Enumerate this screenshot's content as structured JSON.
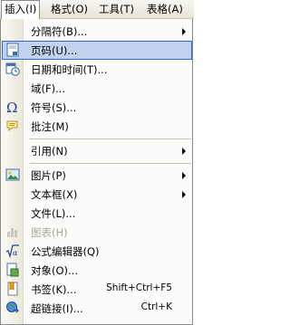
{
  "menubar": {
    "items": [
      "插入(I)",
      "格式(O)",
      "工具(T)",
      "表格(A)"
    ]
  },
  "menu": {
    "items": [
      {
        "label": "分隔符(B)...",
        "shortcut": "",
        "submenu": true,
        "icon": "none"
      },
      {
        "label": "页码(U)...",
        "shortcut": "",
        "submenu": false,
        "icon": "page-number-icon",
        "highlighted": true
      },
      {
        "label": "日期和时间(T)...",
        "shortcut": "",
        "submenu": false,
        "icon": "date-time-icon"
      },
      {
        "label": "域(F)...",
        "shortcut": "",
        "submenu": false,
        "icon": "none"
      },
      {
        "label": "符号(S)...",
        "shortcut": "",
        "submenu": false,
        "icon": "omega-icon"
      },
      {
        "label": "批注(M)",
        "shortcut": "",
        "submenu": false,
        "icon": "comment-icon"
      },
      {
        "label": "引用(N)",
        "shortcut": "",
        "submenu": true,
        "icon": "none"
      },
      {
        "label": "图片(P)",
        "shortcut": "",
        "submenu": true,
        "icon": "picture-icon"
      },
      {
        "label": "文本框(X)",
        "shortcut": "",
        "submenu": true,
        "icon": "none"
      },
      {
        "label": "文件(L)...",
        "shortcut": "",
        "submenu": false,
        "icon": "none"
      },
      {
        "label": "图表(H)",
        "shortcut": "",
        "submenu": false,
        "icon": "chart-icon",
        "disabled": true
      },
      {
        "label": "公式编辑器(Q)",
        "shortcut": "",
        "submenu": false,
        "icon": "equation-icon"
      },
      {
        "label": "对象(O)...",
        "shortcut": "",
        "submenu": false,
        "icon": "object-icon"
      },
      {
        "label": "书签(K)...",
        "shortcut": "Shift+Ctrl+F5",
        "submenu": false,
        "icon": "bookmark-icon"
      },
      {
        "label": "超链接(I)...",
        "shortcut": "Ctrl+K",
        "submenu": false,
        "icon": "hyperlink-icon"
      }
    ]
  },
  "colors": {
    "highlight_bg": "#c1d2ee",
    "highlight_border": "#316ac5",
    "disabled_text": "#a7a69b"
  }
}
